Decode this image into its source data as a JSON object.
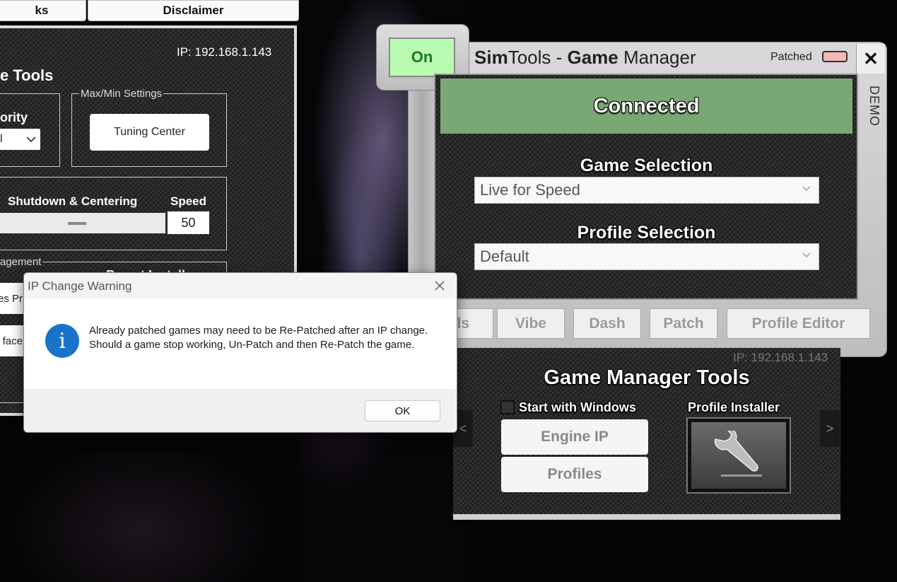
{
  "main_window": {
    "tabs": [
      "ks",
      "Disclaimer"
    ],
    "ip_label": "IP: 192.168.1.143",
    "section_title": "e Tools",
    "priority_label": "ority",
    "priority_value": "l",
    "max_min_group": "Max/Min Settings",
    "tuning_center_button": "Tuning Center",
    "shutdown_label": "Shutdown & Centering",
    "speed_label": "Speed",
    "speed_value": "50",
    "management_group": "agement",
    "preset_installer_group": "Preset Installer",
    "btn_files": "es Pr",
    "btn_interface": "face"
  },
  "game_manager": {
    "on_button": "On",
    "title_sim": "Sim",
    "title_tools": "Tools - ",
    "title_game": "Game",
    "title_manager": " Manager",
    "patched_label": "Patched",
    "close_glyph": "✕",
    "demo_label": "DEMO",
    "status": "Connected",
    "game_selection_label": "Game Selection",
    "game_selected": "Live for Speed",
    "profile_selection_label": "Profile Selection",
    "profile_selected": "Default",
    "tabs": [
      "ols",
      "Vibe",
      "Dash",
      "Patch",
      "Profile Editor"
    ],
    "colors": {
      "connected": "#7aa874",
      "on": "#b9fbb0",
      "patched_led": "#f6b7b7"
    }
  },
  "gm_tools": {
    "ip_label": "IP: 192.168.1.143",
    "title": "Game Manager Tools",
    "start_with_windows": "Start with Windows",
    "start_with_windows_checked": false,
    "profile_installer_label": "Profile Installer",
    "engine_ip_button": "Engine IP",
    "profiles_button": "Profiles",
    "prev_arrow": "<",
    "next_arrow": ">"
  },
  "dialog": {
    "title": "IP Change Warning",
    "message": "Already patched games may need to be Re-Patched after an IP change. Should a game stop working, Un-Patch and then Re-Patch the game.",
    "ok_button": "OK",
    "icon": "info-icon",
    "icon_glyph": "i"
  }
}
